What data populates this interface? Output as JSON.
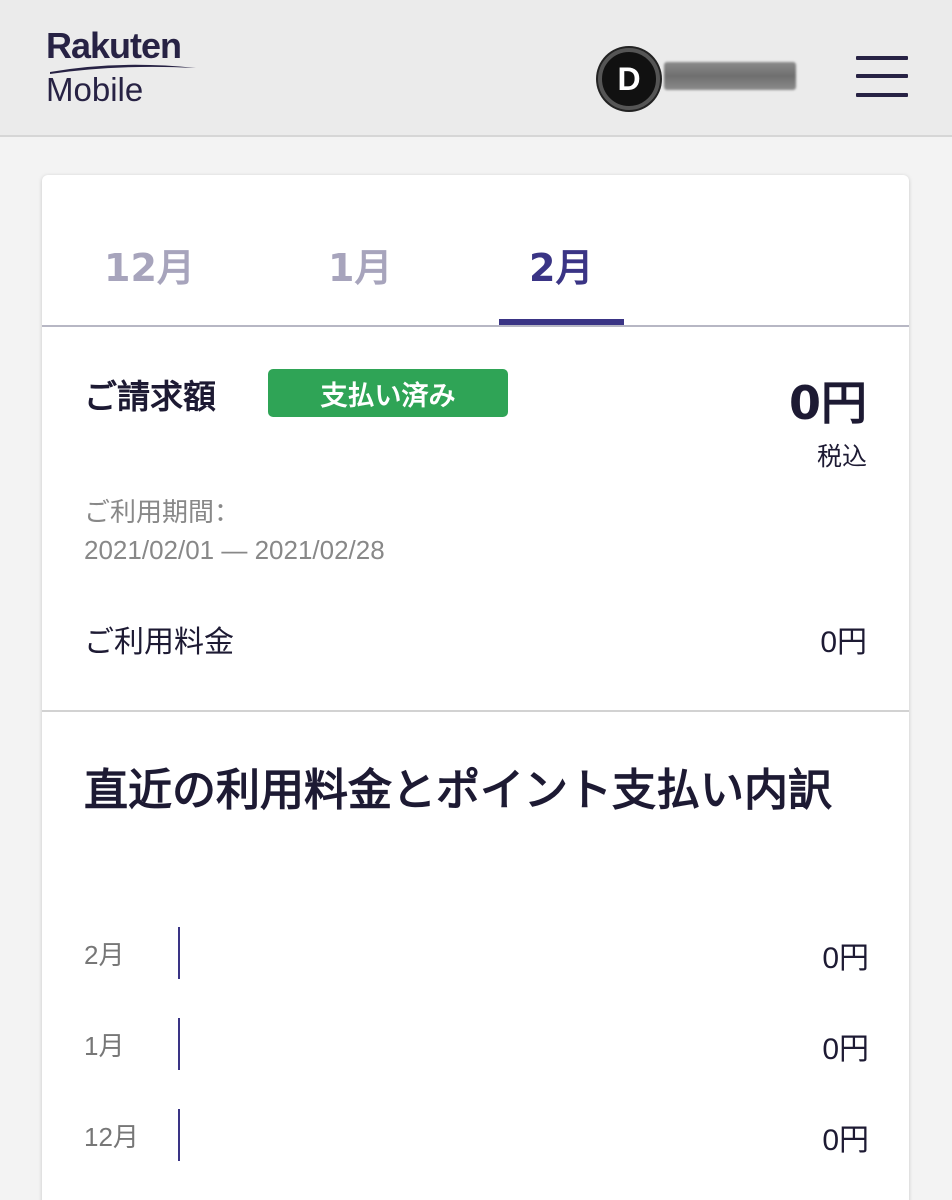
{
  "header": {
    "brand_line1": "Rakuten",
    "brand_line2": "Mobile",
    "avatar_initial": "D",
    "menu_icon": "hamburger-icon"
  },
  "tabs": [
    {
      "label": "12月",
      "active": false
    },
    {
      "label": "1月",
      "active": false
    },
    {
      "label": "2月",
      "active": true
    }
  ],
  "bill": {
    "label": "ご請求額",
    "status_badge": "支払い済み",
    "amount": "0円",
    "tax_note": "税込",
    "period_label": "ご利用期間：",
    "period_value": "2021/02/01 — 2021/02/28",
    "usage_label": "ご利用料金",
    "usage_value": "0円"
  },
  "history": {
    "title": "直近の利用料金とポイント支払い内訳",
    "rows": [
      {
        "month": "2月",
        "value": "0円"
      },
      {
        "month": "1月",
        "value": "0円"
      },
      {
        "month": "12月",
        "value": "0円"
      }
    ]
  },
  "colors": {
    "accent": "#3a3485",
    "paid_green": "#2fa456",
    "header_bg": "#ebebeb"
  }
}
